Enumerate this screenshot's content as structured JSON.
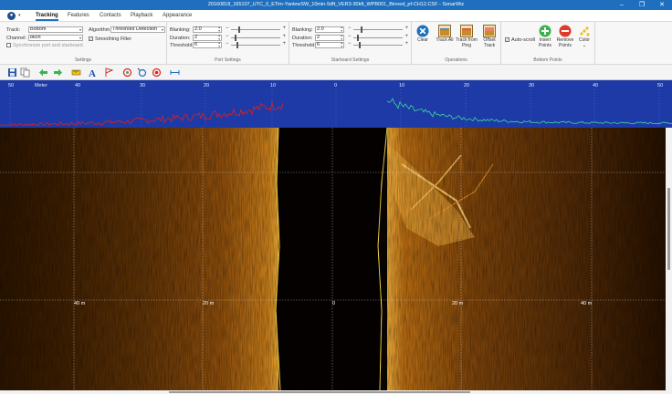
{
  "window": {
    "title": "20160818_165107_UTC_0_ETim-YanlewSW_10min-5dft_VER3-30kft_WPB001_Binned_pf-CH12.CSF - SonarWiz",
    "min": "–",
    "max": "❐",
    "close": "✕"
  },
  "tabs": [
    {
      "label": "Tracking",
      "active": true
    },
    {
      "label": "Features",
      "active": false
    },
    {
      "label": "Contacts",
      "active": false
    },
    {
      "label": "Playback",
      "active": false
    },
    {
      "label": "Appearance",
      "active": false
    }
  ],
  "settings": {
    "track_label": "Track:",
    "track_value": "Bottom",
    "channel_label": "Channel:",
    "channel_value": "8kch",
    "sync_label": "Synchronize port and starboard",
    "algorithm_label": "Algorithm",
    "algorithm_value": "Threshold Detection",
    "smoothing_label": "Smoothing Filter",
    "group_label": "Settings"
  },
  "port": {
    "blanking_label": "Blanking:",
    "blanking_value": "2.0",
    "duration_label": "Duration:",
    "duration_value": "2",
    "threshold_label": "Threshold:",
    "threshold_value": "6",
    "group_label": "Port Settings"
  },
  "starboard": {
    "blanking_label": "Blanking:",
    "blanking_value": "2.0",
    "duration_label": "Duration:",
    "duration_value": "2",
    "threshold_label": "Threshold:",
    "threshold_value": "6",
    "group_label": "Starboard Settings"
  },
  "operations": {
    "clear": "Clear",
    "track_all": "Track All",
    "track_from_ping": "Track from Ping",
    "offset_track": "Offset Track",
    "group_label": "Operations"
  },
  "bottom_points": {
    "auto_scroll": "Auto-scroll",
    "insert": "Insert Points",
    "remove": "Remove Points",
    "color": "Color",
    "group_label": "Bottom Points"
  },
  "profile": {
    "scale": [
      "50",
      "Meter",
      "40",
      "30",
      "20",
      "10",
      "0",
      "10",
      "20",
      "30",
      "40",
      "50"
    ]
  },
  "sonar": {
    "range_labels": [
      "40 m",
      "20 m",
      "0",
      "20 m",
      "40 m"
    ]
  },
  "icons": {
    "app": "app-logo-icon",
    "save": "save-icon",
    "copy": "copy-icon",
    "back": "arrow-left-icon",
    "forward": "arrow-right-icon",
    "measure": "measure-icon",
    "text": "text-icon",
    "flag": "flag-icon",
    "target": "target-icon",
    "target2": "target-add-icon",
    "target3": "target-remove-icon",
    "ruler": "ruler-icon"
  },
  "colors": {
    "titlebar": "#1f6fbf",
    "profile_bg": "#1d3aa6",
    "port_trace": "#e02020",
    "stbd_trace": "#3fd89a"
  }
}
